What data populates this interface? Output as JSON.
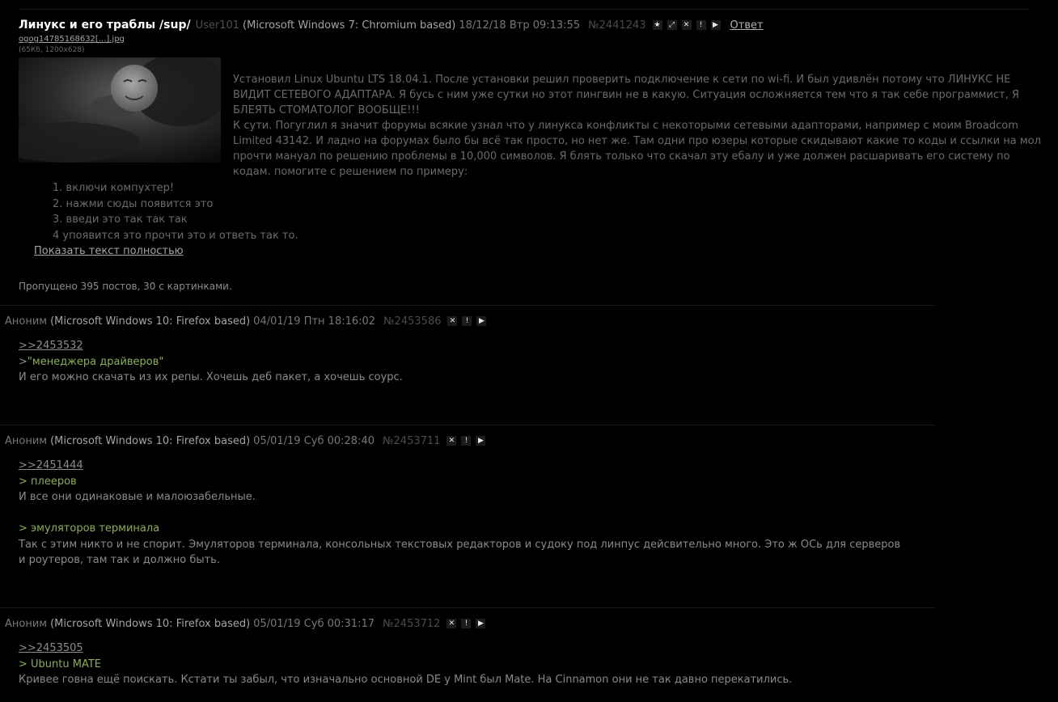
{
  "op": {
    "title": "Линукс и его траблы /sup/",
    "poster": "User101",
    "ua": "(Microsoft Windows 7: Chromium based)",
    "date": "18/12/18 Втр 09:13:55",
    "num": "№2441243",
    "buttons": [
      "★",
      "⤢",
      "✕",
      "!",
      "▶"
    ],
    "reply": "Ответ",
    "file_name": "ogog14785168632[...].jpg",
    "file_meta": "(65Кб, 1200x628)",
    "text": [
      "Установил Linux Ubuntu LTS 18.04.1. После установки решил проверить подключение к сети по wi-fi. И был удивлён потому что ЛИНУКС НЕ ВИДИТ СЕТЕВОГО АДАПТАРА. Я бусь с ним уже сутки но этот пингвин не в какую. Ситуация осложняется тем что я так себе программист, Я БЛЕЯТЬ СТОМАТОЛОГ ВООБЩЕ!!!",
      "К сути. Погуглил я значит форумы всякие узнал что у линукса конфликты с некоторыми сетевыми адапторами, например с моим Broadcom Limited 43142. И ладно на форумах было бы всё так просто, но нет же. Там одни про юзеры которые скидывают какие то коды и ссылки на мол прочти мануал по решению проблемы в 10,000 символов. Я блять только что скачал эту ебалу и уже должен расшаривать его систему по кодам. помогите с решением по примеру:"
    ],
    "list": [
      "1. включи компухтер!",
      "2. нажми сюды появится это",
      "3. введи это так так так",
      "4 упоявится это прочти это и ответь так то."
    ],
    "show_full": "Показать текст полностью"
  },
  "omitted": "Пропущено 395 постов, 30 с картинками.",
  "posts": [
    {
      "poster": "Аноним",
      "ua": "(Microsoft Windows 10: Firefox based)",
      "date": "04/01/19 Птн 18:16:02",
      "num": "№2453586",
      "buttons": [
        "✕",
        "!",
        "▶"
      ],
      "backlink": ">>2453532",
      "q1_gt": ">",
      "q1_text": "\"менеджера драйверов\"",
      "line1": "И его можно скачать из их репы. Хочешь деб пакет, а хочешь соурс."
    },
    {
      "poster": "Аноним",
      "ua": "(Microsoft Windows 10: Firefox based)",
      "date": "05/01/19 Суб 00:28:40",
      "num": "№2453711",
      "buttons": [
        "✕",
        "!",
        "▶"
      ],
      "backlink": ">>2451444",
      "q1": "> плееров",
      "line1": "И все они одинаковые и малоюзабельные.",
      "q2": "> эмуляторов терминала",
      "line2": "Так с этим никто и не спорит. Эмуляторов терминала, консольных текстовых редакторов и судоку под линпус дейсвительно много. Это ж ОСь для серверов",
      "line3": "и роутеров, там так и должно быть."
    },
    {
      "poster": "Аноним",
      "ua": "(Microsoft Windows 10: Firefox based)",
      "date": "05/01/19 Суб 00:31:17",
      "num": "№2453712",
      "buttons": [
        "✕",
        "!",
        "▶"
      ],
      "backlink": ">>2453505",
      "q1": "> Ubuntu MATE",
      "line1": "Кривее говна ещё поискать. Кстати ты забыл, что изначально основной DE у Mint был Mate. На Cinnamon они не так давно перекатились."
    }
  ],
  "colors": {
    "background": "#000000",
    "title": "#ffffff",
    "quote": "#8cad5a",
    "text": "#8a8a8a",
    "muted": "#4b4b4b"
  },
  "icons": {
    "star": "star-icon",
    "expand": "expand-icon",
    "hide": "close-icon",
    "report": "report-icon",
    "play": "play-icon"
  }
}
